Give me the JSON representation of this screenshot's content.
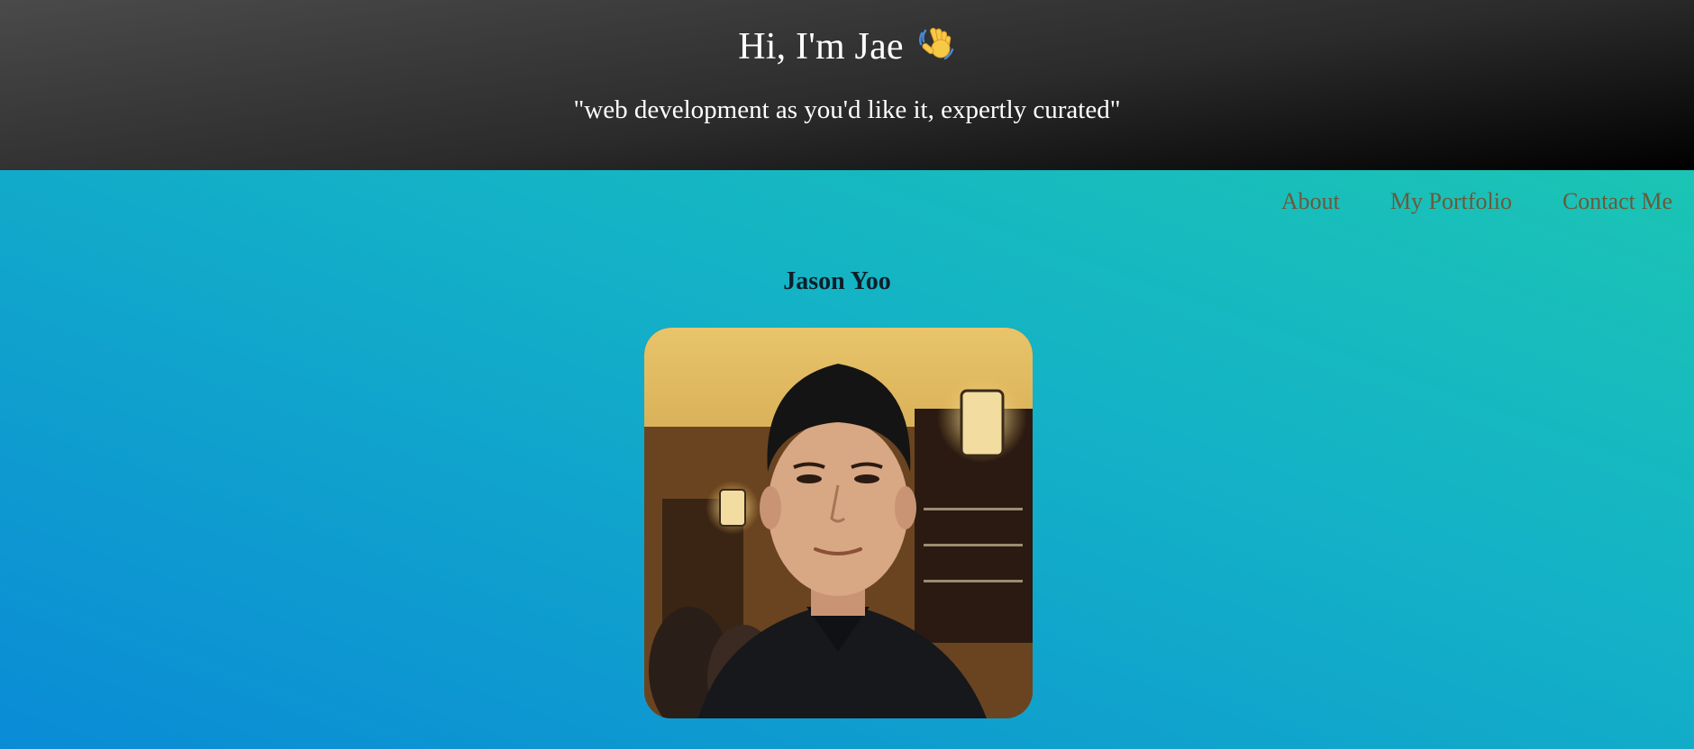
{
  "header": {
    "title": "Hi, I'm Jae",
    "wave_icon": "waving-hand-icon",
    "tagline": "\"web development as you'd like it, expertly curated\""
  },
  "nav": {
    "items": [
      {
        "label": "About"
      },
      {
        "label": "My Portfolio"
      },
      {
        "label": "Contact Me"
      }
    ]
  },
  "profile": {
    "name": "Jason Yoo"
  },
  "colors": {
    "header_dark": "#000000",
    "header_light": "#4a4a4a",
    "background_teal": "#1ecbad",
    "background_blue": "#0a8bd6",
    "nav_link": "#6a5a3a",
    "name_text": "#0d1f2a"
  }
}
